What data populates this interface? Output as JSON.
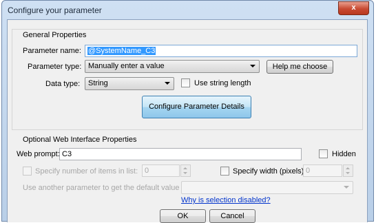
{
  "window": {
    "title": "Configure your parameter",
    "close_label": "x"
  },
  "general": {
    "heading": "General Properties",
    "name_label": "Parameter name:",
    "name_value": "@SystemName_C3",
    "type_label": "Parameter type:",
    "type_value": "Manually enter a value",
    "help_button": "Help me choose",
    "datatype_label": "Data type:",
    "datatype_value": "String",
    "use_length_label": "Use string length",
    "configure_button": "Configure Parameter Details"
  },
  "web": {
    "heading": "Optional Web Interface Properties",
    "prompt_label": "Web prompt:",
    "prompt_value": "C3",
    "hidden_label": "Hidden",
    "items_label": "Specify number of items in list:",
    "items_value": "0",
    "width_label": "Specify width (pixels):",
    "width_value": "0",
    "default_label": "Use another parameter to get the default value",
    "default_value": "",
    "why_link": "Why is selection disabled?"
  },
  "footer": {
    "ok": "OK",
    "cancel": "Cancel"
  }
}
